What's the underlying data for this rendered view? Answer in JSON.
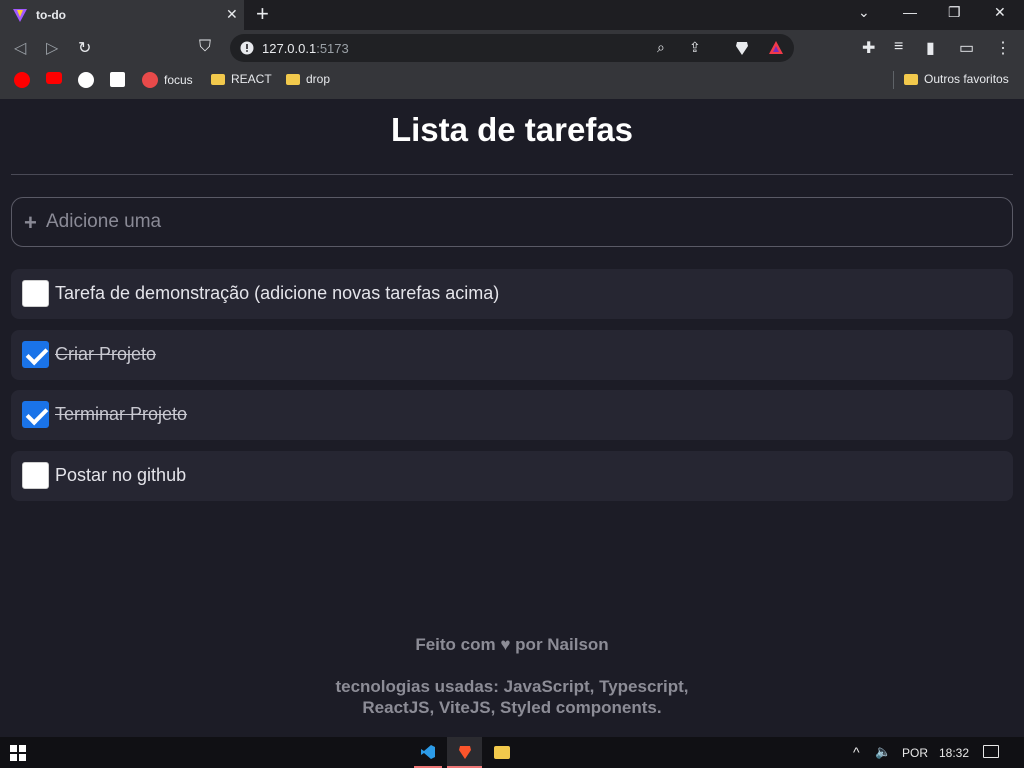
{
  "browser": {
    "tab_title": "to-do",
    "url_host": "127.0.0.1",
    "url_port": ":5173",
    "bookmarks": [
      "focus",
      "REACT",
      "drop"
    ],
    "other_bookmarks": "Outros favoritos"
  },
  "app": {
    "title": "Lista de tarefas",
    "input_placeholder": "Adicione uma",
    "tasks": [
      {
        "label": "Tarefa de demonstração (adicione novas tarefas acima)",
        "done": false
      },
      {
        "label": "Criar Projeto",
        "done": true
      },
      {
        "label": "Terminar Projeto",
        "done": true
      },
      {
        "label": "Postar no github",
        "done": false
      }
    ],
    "footer_made_with": "Feito com",
    "footer_by": "por Nailson",
    "footer_tech_line1": "tecnologias usadas: JavaScript, Typescript,",
    "footer_tech_line2": "ReactJS, ViteJS, Styled components."
  },
  "taskbar": {
    "language": "POR",
    "time": "18:32"
  },
  "colors": {
    "page_bg": "#1c1c26",
    "task_bg": "#262632",
    "checkbox_checked": "#1a73e8"
  }
}
